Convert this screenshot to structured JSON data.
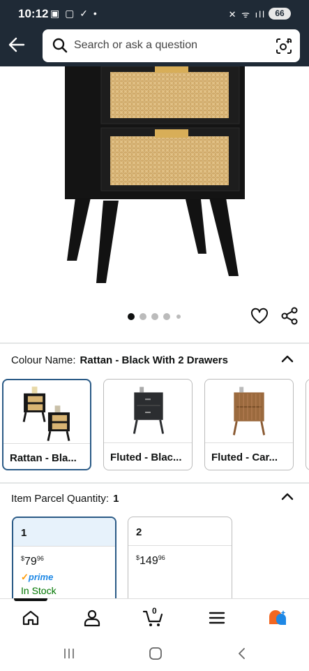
{
  "status_bar": {
    "time": "10:12",
    "left_icons": "▣ ▢ ✓ •",
    "right_icons": "✕ ᯤ ıll",
    "battery": "66"
  },
  "search": {
    "placeholder": "Search or ask a question"
  },
  "gallery": {
    "image_count": 5,
    "active_index": 0
  },
  "colour": {
    "label": "Colour Name:",
    "value": "Rattan - Black With 2 Drawers",
    "options": [
      {
        "label": "Rattan - Bla...",
        "selected": true
      },
      {
        "label": "Fluted - Blac...",
        "selected": false
      },
      {
        "label": "Fluted - Car...",
        "selected": false
      }
    ]
  },
  "quantity": {
    "label": "Item Parcel Quantity:",
    "value": "1",
    "options": [
      {
        "qty": "1",
        "currency": "$",
        "price_whole": "79",
        "price_frac": "96",
        "prime": "prime",
        "stock": "In Stock",
        "selected": true
      },
      {
        "qty": "2",
        "currency": "$",
        "price_whole": "149",
        "price_frac": "96",
        "selected": false
      }
    ]
  },
  "nav": {
    "cart_count": "0"
  },
  "colors": {
    "header_bg": "#1f2a36",
    "selected_border": "#2a5a86",
    "in_stock": "#007600",
    "prime_blue": "#1e88e5"
  },
  "icons": [
    "back-arrow-icon",
    "search-icon",
    "camera-scan-icon",
    "heart-icon",
    "share-icon",
    "chevron-up-icon",
    "home-icon",
    "profile-icon",
    "cart-icon",
    "menu-icon",
    "rufus-icon"
  ]
}
